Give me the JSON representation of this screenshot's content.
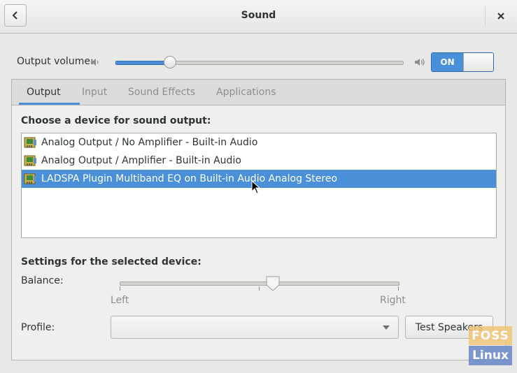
{
  "window": {
    "title": "Sound"
  },
  "output_volume": {
    "label": "Output volume:",
    "level": 0.19,
    "switch_label": "ON"
  },
  "tabs": [
    {
      "label": "Output",
      "active": true
    },
    {
      "label": "Input",
      "active": false
    },
    {
      "label": "Sound Effects",
      "active": false
    },
    {
      "label": "Applications",
      "active": false
    }
  ],
  "output_page": {
    "choose_title": "Choose a device for sound output:",
    "devices": [
      {
        "label": "Analog Output / No Amplifier - Built-in Audio",
        "selected": false
      },
      {
        "label": "Analog Output / Amplifier - Built-in Audio",
        "selected": false
      },
      {
        "label": "LADSPA Plugin Multiband EQ on Built-in Audio Analog Stereo",
        "selected": true
      }
    ],
    "settings_title": "Settings for the selected device:",
    "balance": {
      "label": "Balance:",
      "left_label": "Left",
      "right_label": "Right",
      "value": 0.55
    },
    "profile": {
      "label": "Profile:",
      "value": ""
    },
    "test_speakers_label": "Test Speakers"
  },
  "watermark": {
    "line1": "FOSS",
    "line2": "Linux"
  },
  "colors": {
    "accent": "#4a90d9",
    "switch_border": "#2c6ab3"
  },
  "icons": [
    "back-arrow-icon",
    "close-icon",
    "speaker-low-icon",
    "speaker-high-icon",
    "sound-card-icon",
    "dropdown-arrow-icon",
    "mouse-pointer-icon"
  ]
}
